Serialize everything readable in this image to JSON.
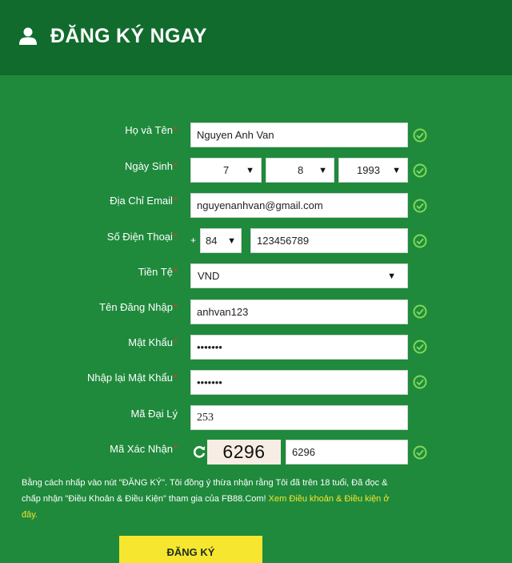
{
  "header": {
    "title": "ĐĂNG KÝ NGAY"
  },
  "required_mark": "*",
  "form": {
    "fullname": {
      "label": "Họ và Tên",
      "value": "Nguyen Anh Van"
    },
    "birthdate": {
      "label": "Ngày Sinh",
      "day": "7",
      "month": "8",
      "year": "1993"
    },
    "email": {
      "label": "Địa Chỉ Email",
      "value": "nguyenanhvan@gmail.com"
    },
    "phone": {
      "label": "Số Điện Thoại",
      "prefix": "+",
      "country_code": "84",
      "value": "123456789"
    },
    "currency": {
      "label": "Tiền Tệ",
      "value": "VND"
    },
    "username": {
      "label": "Tên Đăng Nhập",
      "value": "anhvan123"
    },
    "password": {
      "label": "Mật Khẩu",
      "value": "•••••••"
    },
    "password_confirm": {
      "label": "Nhập lại Mật Khẩu",
      "value": "•••••••"
    },
    "agent_code": {
      "label": "Mã Đại Lý",
      "value": "253"
    },
    "captcha": {
      "label": "Mã Xác Nhận",
      "image_text": "6296",
      "value": "6296"
    }
  },
  "terms": {
    "text": "Bằng cách nhấp vào nút \"ĐĂNG KÝ\". Tôi đồng ý thừa nhận rằng Tôi đã trên 18 tuổi, Đã đọc & chấp nhận \"Điều Khoản & Điều Kiện\" tham gia của FB88.Com!",
    "link": "Xem Điều khoản & Điều kiện ở đây."
  },
  "submit_label": "ĐĂNG KÝ",
  "colors": {
    "background": "#1f8a3c",
    "header": "#116b2c",
    "button": "#f6e62f",
    "link": "#f6e42f",
    "required": "#e53935",
    "check": "#7ed957"
  },
  "icons": {
    "header": "user-icon",
    "valid": "check-circle-icon",
    "refresh": "refresh-icon",
    "dropdown": "caret-down-icon"
  }
}
